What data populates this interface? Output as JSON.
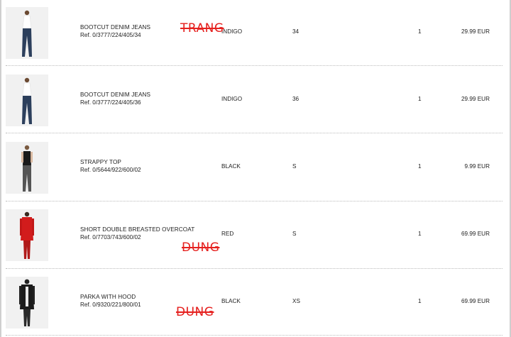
{
  "items": [
    {
      "name": "BOOTCUT DENIM JEANS",
      "ref": "Ref. 0/3777/224/405/34",
      "color": "INDIGO",
      "size": "34",
      "qty": "1",
      "price": "29.99 EUR",
      "figure": "jeans"
    },
    {
      "name": "BOOTCUT DENIM JEANS",
      "ref": "Ref. 0/3777/224/405/36",
      "color": "INDIGO",
      "size": "36",
      "qty": "1",
      "price": "29.99 EUR",
      "figure": "jeans"
    },
    {
      "name": "STRAPPY TOP",
      "ref": "Ref. 0/5644/922/600/02",
      "color": "BLACK",
      "size": "S",
      "qty": "1",
      "price": "9.99 EUR",
      "figure": "top"
    },
    {
      "name": "SHORT DOUBLE BREASTED OVERCOAT",
      "ref": "Ref. 0/7703/743/600/02",
      "color": "RED",
      "size": "S",
      "qty": "1",
      "price": "69.99 EUR",
      "figure": "coat"
    },
    {
      "name": "PARKA WITH HOOD",
      "ref": "Ref. 0/9320/221/800/01",
      "color": "BLACK",
      "size": "XS",
      "qty": "1",
      "price": "69.99 EUR",
      "figure": "parka"
    }
  ],
  "annotations": {
    "row1": "TRANG",
    "row4": "DUNG",
    "row5": "DUNG"
  },
  "colors": {
    "annotation": "#e5201e",
    "separator": "#bbbbbb",
    "border": "#cfcfcf"
  }
}
